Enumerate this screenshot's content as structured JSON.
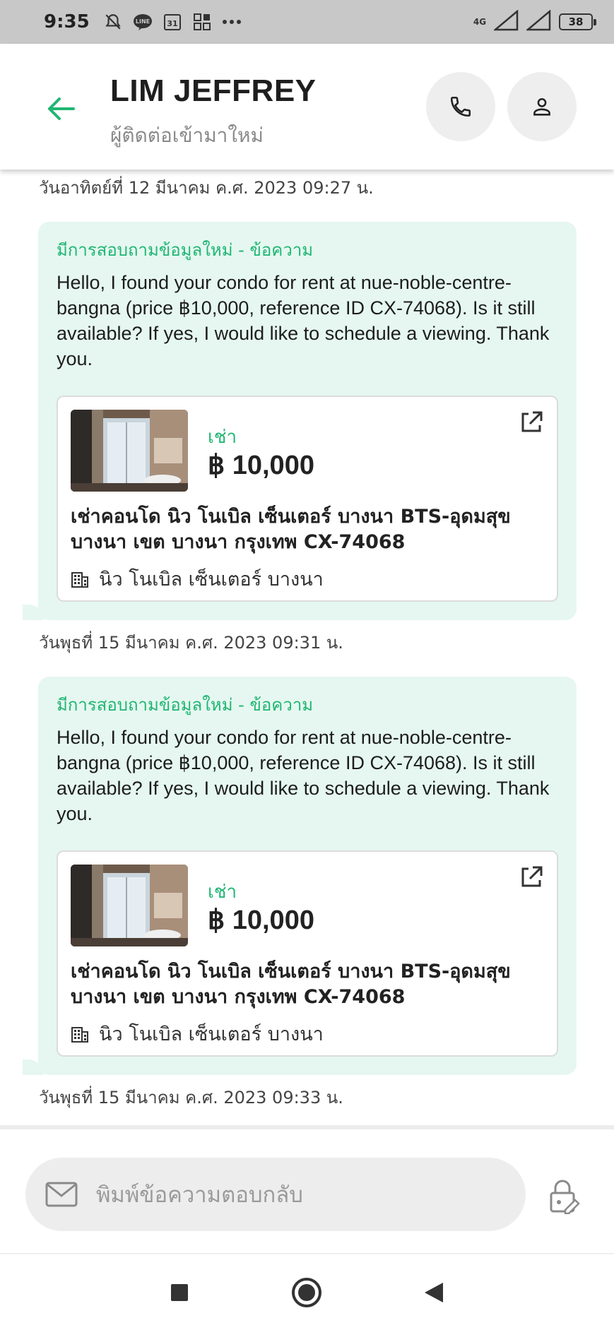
{
  "status_bar": {
    "time": "9:35",
    "network": "4G",
    "battery": "38"
  },
  "header": {
    "title": "LIM JEFFREY",
    "subtitle": "ผู้ติดต่อเข้ามาใหม่"
  },
  "colors": {
    "accent": "#20b673",
    "bubble_bg": "#e5f7f0",
    "header_bg": "#ffffff",
    "status_bar_bg": "#c8c8c8"
  },
  "messages": [
    {
      "timestamp": "วันอาทิตย์ที่ 12 มีนาคม ค.ศ. 2023 09:27 น.",
      "heading": "มีการสอบถามข้อมูลใหม่ - ข้อความ",
      "body": "Hello, I found your condo for rent at nue-noble-centre-bangna (price ฿10,000, reference ID CX-74068). Is it still available? If yes, I would like to schedule a viewing. Thank you.",
      "listing": {
        "type": "เช่า",
        "price": "฿ 10,000",
        "title": "เช่าคอนโด  นิว โนเบิล เซ็นเตอร์ บางนา BTS-อุดมสุข บางนา เขต บางนา กรุงเทพ CX-74068",
        "project": "นิว โนเบิล เซ็นเตอร์ บางนา"
      }
    },
    {
      "timestamp": "วันพุธที่ 15 มีนาคม ค.ศ. 2023 09:31 น.",
      "heading": "มีการสอบถามข้อมูลใหม่ - ข้อความ",
      "body": "Hello, I found your condo for rent at nue-noble-centre-bangna (price ฿10,000, reference ID CX-74068). Is it still available? If yes, I would like to schedule a viewing. Thank you.",
      "listing": {
        "type": "เช่า",
        "price": "฿ 10,000",
        "title": "เช่าคอนโด  นิว โนเบิล เซ็นเตอร์ บางนา BTS-อุดมสุข บางนา เขต บางนา กรุงเทพ CX-74068",
        "project": "นิว โนเบิล เซ็นเตอร์ บางนา"
      }
    }
  ],
  "last_timestamp": "วันพุธที่ 15 มีนาคม ค.ศ. 2023 09:33 น.",
  "reply": {
    "placeholder": "พิมพ์ข้อความตอบกลับ"
  },
  "icons": {
    "back": "arrow-left-icon",
    "call": "phone-icon",
    "profile": "person-icon",
    "external": "external-link-icon",
    "building": "building-icon",
    "mail": "mail-icon",
    "lock": "lock-edit-icon"
  }
}
